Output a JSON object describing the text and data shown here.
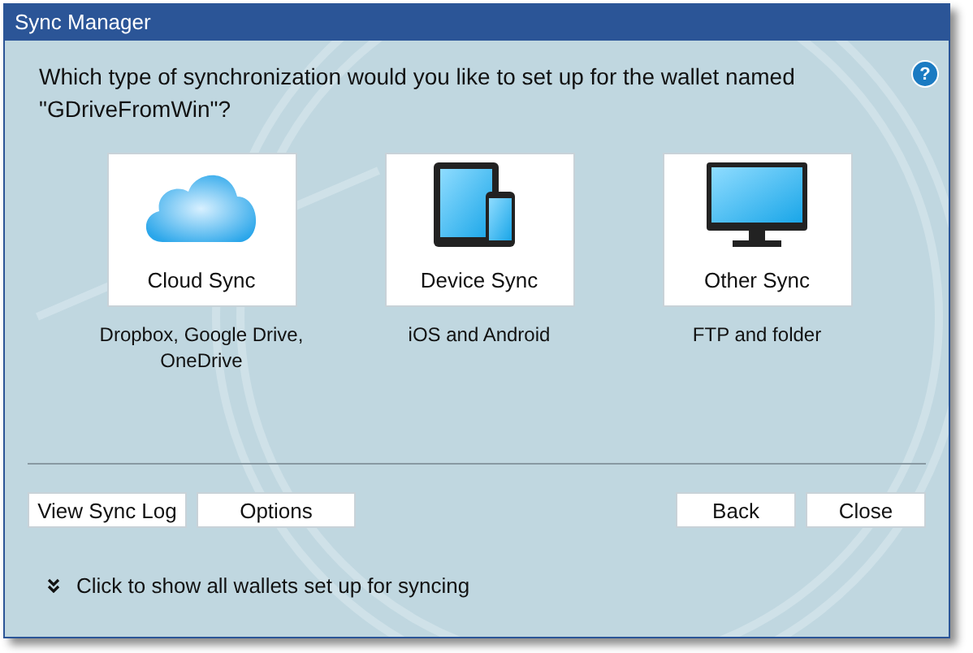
{
  "window": {
    "title": "Sync Manager"
  },
  "question": "Which type of synchronization would you like to set up for the wallet named \"GDriveFromWin\"?",
  "help_icon": "?",
  "tiles": [
    {
      "kind": "cloud",
      "label": "Cloud Sync",
      "description": "Dropbox, Google Drive, OneDrive"
    },
    {
      "kind": "device",
      "label": "Device Sync",
      "description": "iOS and Android"
    },
    {
      "kind": "monitor",
      "label": "Other Sync",
      "description": "FTP and folder"
    }
  ],
  "left_buttons": [
    "View Sync Log",
    "Options"
  ],
  "right_buttons": [
    "Back",
    "Close"
  ],
  "expander": {
    "label": "Click to show all wallets set up for syncing",
    "expanded": false
  }
}
